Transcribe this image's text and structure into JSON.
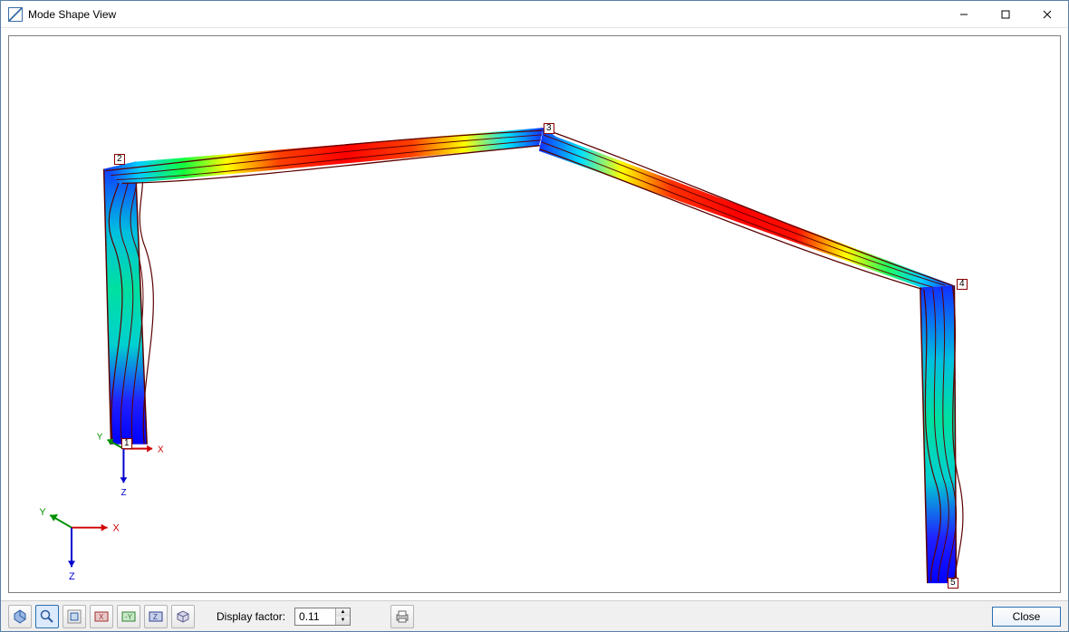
{
  "window": {
    "title": "Mode Shape View"
  },
  "statusbar": {
    "display_factor_label": "Display factor:",
    "display_factor_value": "0.11",
    "close_label": "Close"
  },
  "nodes": {
    "n1": "1",
    "n2": "2",
    "n3": "3",
    "n4": "4",
    "n5": "5"
  },
  "axes": {
    "x": "X",
    "y": "Y",
    "z": "Z"
  },
  "colors": {
    "blue": "#0000ff",
    "cyan": "#00e0e0",
    "green": "#00d000",
    "yellow": "#ffff00",
    "red": "#ff0000",
    "darkred": "#8b0000"
  }
}
